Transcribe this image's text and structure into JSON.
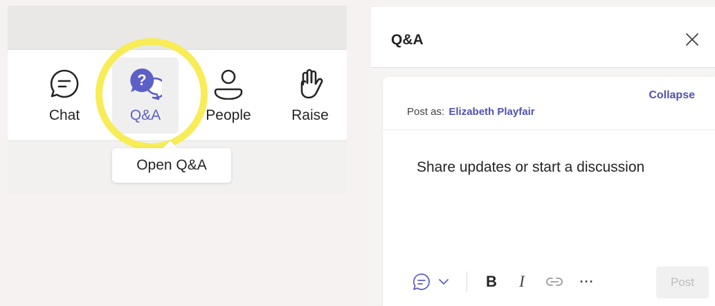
{
  "toolbar": {
    "buttons": [
      {
        "id": "chat",
        "label": "Chat",
        "icon": "chat-icon"
      },
      {
        "id": "qa",
        "label": "Q&A",
        "icon": "qa-icon",
        "active": true
      },
      {
        "id": "people",
        "label": "People",
        "icon": "people-icon"
      },
      {
        "id": "raise",
        "label": "Raise",
        "icon": "raise-hand-icon"
      }
    ],
    "tooltip": "Open Q&A",
    "active_color": "#5b5fc7",
    "highlight_color": "#f8ec57"
  },
  "panel": {
    "title": "Q&A",
    "close_icon": "close-icon",
    "compose": {
      "collapse_label": "Collapse",
      "post_as_label": "Post as:",
      "post_as_name": "Elizabeth Playfair",
      "placeholder": "Share updates or start a discussion",
      "format": {
        "post_type_icon": "chat-bubble-icon",
        "dropdown_icon": "chevron-down-icon",
        "bold": "B",
        "italic": "I",
        "link_icon": "link-icon",
        "more": "···"
      },
      "post_label": "Post",
      "accent_color": "#4f52b2"
    }
  }
}
